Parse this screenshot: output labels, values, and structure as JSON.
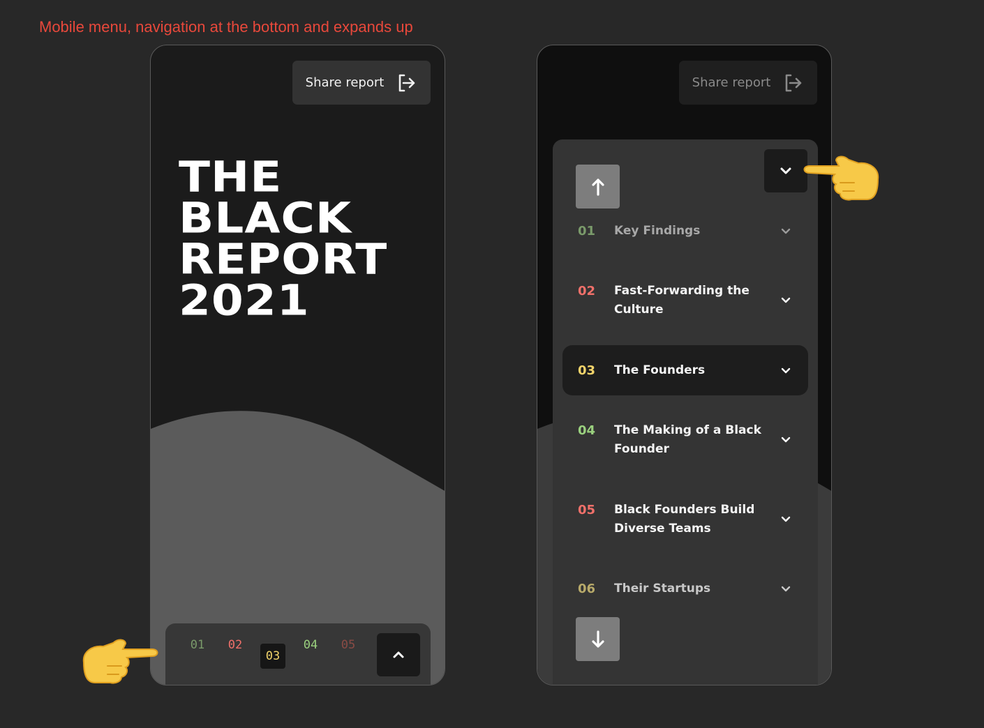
{
  "caption": "Mobile menu, navigation at the bottom and expands up",
  "share_button": {
    "label": "Share report",
    "icon": "share-exit-icon"
  },
  "hero": {
    "lines": [
      "The",
      "Black",
      "Report",
      "2021"
    ]
  },
  "colors": {
    "num_01": "#7a9a6a",
    "num_02": "#f0706a",
    "num_03": "#f1d36a",
    "num_04": "#9ad07e",
    "num_05": "#8a4b45",
    "num_06": "#b8aa6a"
  },
  "bottom_nav": {
    "numbers": [
      "01",
      "02",
      "03",
      "04",
      "05"
    ],
    "active": "03",
    "expand_icon": "chevron-up-icon"
  },
  "menu": {
    "collapse_icon": "chevron-down-icon",
    "scroll_up_icon": "arrow-up-icon",
    "scroll_down_icon": "arrow-down-icon",
    "items": [
      {
        "num": "01",
        "label": "Key Findings"
      },
      {
        "num": "02",
        "label": "Fast-Forwarding the Culture"
      },
      {
        "num": "03",
        "label": "The Founders"
      },
      {
        "num": "04",
        "label": "The Making of a Black Founder"
      },
      {
        "num": "05",
        "label": "Black Founders Build Diverse Teams"
      },
      {
        "num": "06",
        "label": "Their Startups"
      }
    ],
    "active": "03"
  }
}
